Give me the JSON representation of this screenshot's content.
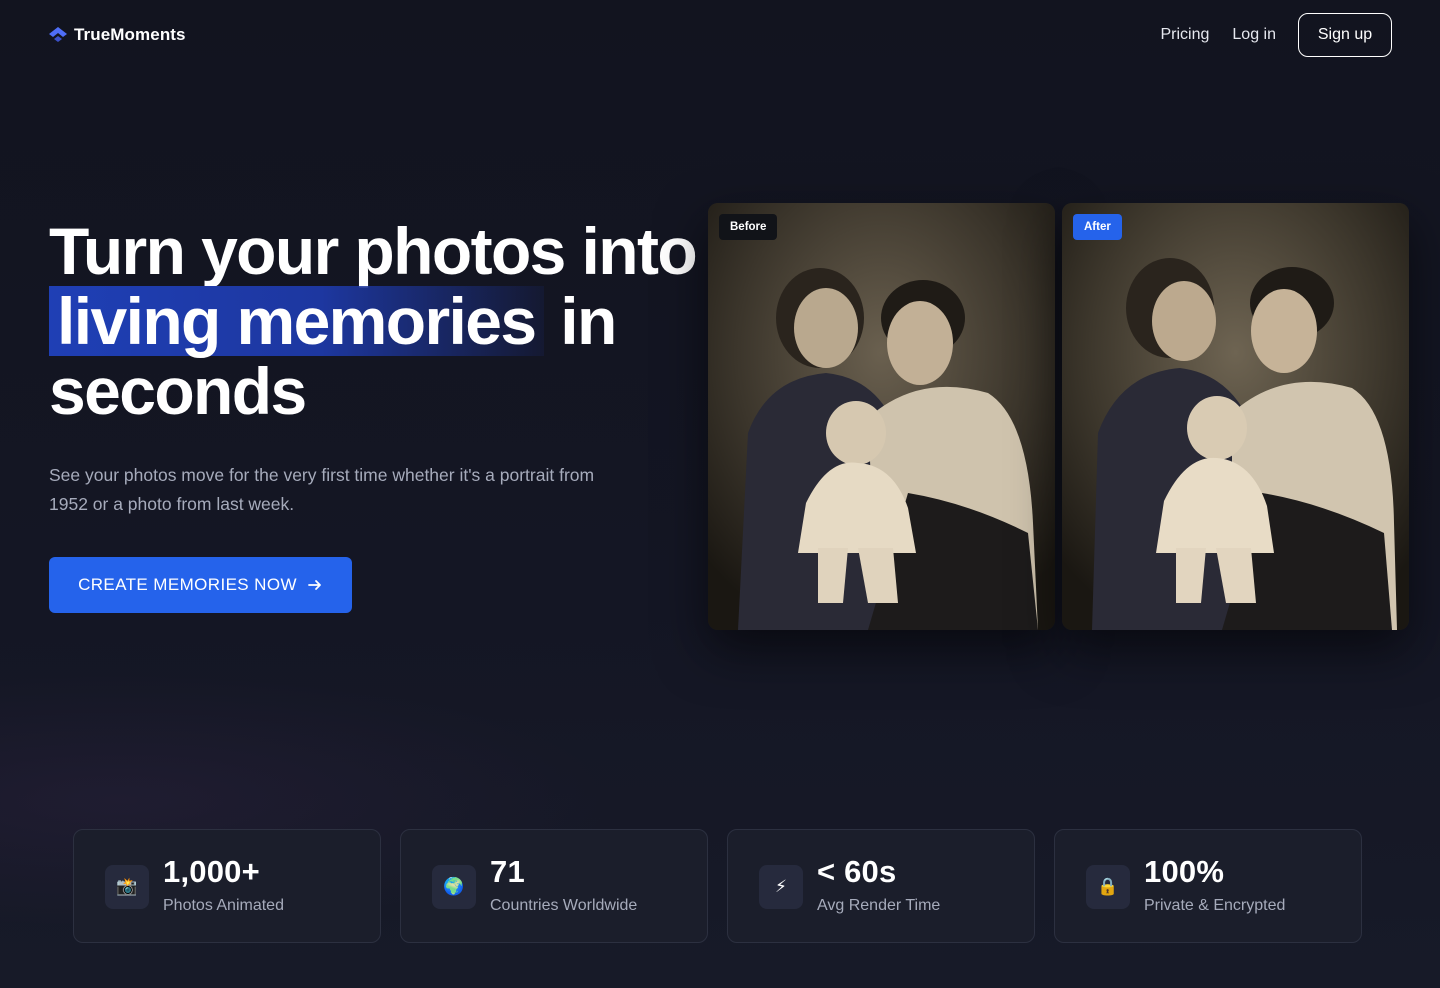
{
  "brand": {
    "name": "TrueMoments",
    "logo_icon": "chevron-up-logo-icon",
    "accent": "#4f6ef7"
  },
  "nav": {
    "pricing": "Pricing",
    "login": "Log in",
    "signup": "Sign up"
  },
  "hero": {
    "title_line1": "Turn your photos into",
    "title_highlight": "living memories",
    "title_line2_rest": " in",
    "title_line3": "seconds",
    "subtitle": "See your photos move for the very first time whether it's a portrait from 1952 or a photo from last week.",
    "cta_label": "CREATE MEMORIES NOW",
    "cta_icon": "arrow-right-icon",
    "cta_color": "#2563eb"
  },
  "comparison": {
    "before_label": "Before",
    "after_label": "After"
  },
  "stats": [
    {
      "icon": "📸",
      "icon_name": "camera-icon",
      "value": "1,000+",
      "label": "Photos Animated"
    },
    {
      "icon": "🌍",
      "icon_name": "globe-icon",
      "value": "71",
      "label": "Countries Worldwide"
    },
    {
      "icon": "⚡",
      "icon_name": "lightning-icon",
      "value": "< 60s",
      "label": "Avg Render Time"
    },
    {
      "icon": "🔒",
      "icon_name": "lock-icon",
      "value": "100%",
      "label": "Private & Encrypted"
    }
  ]
}
